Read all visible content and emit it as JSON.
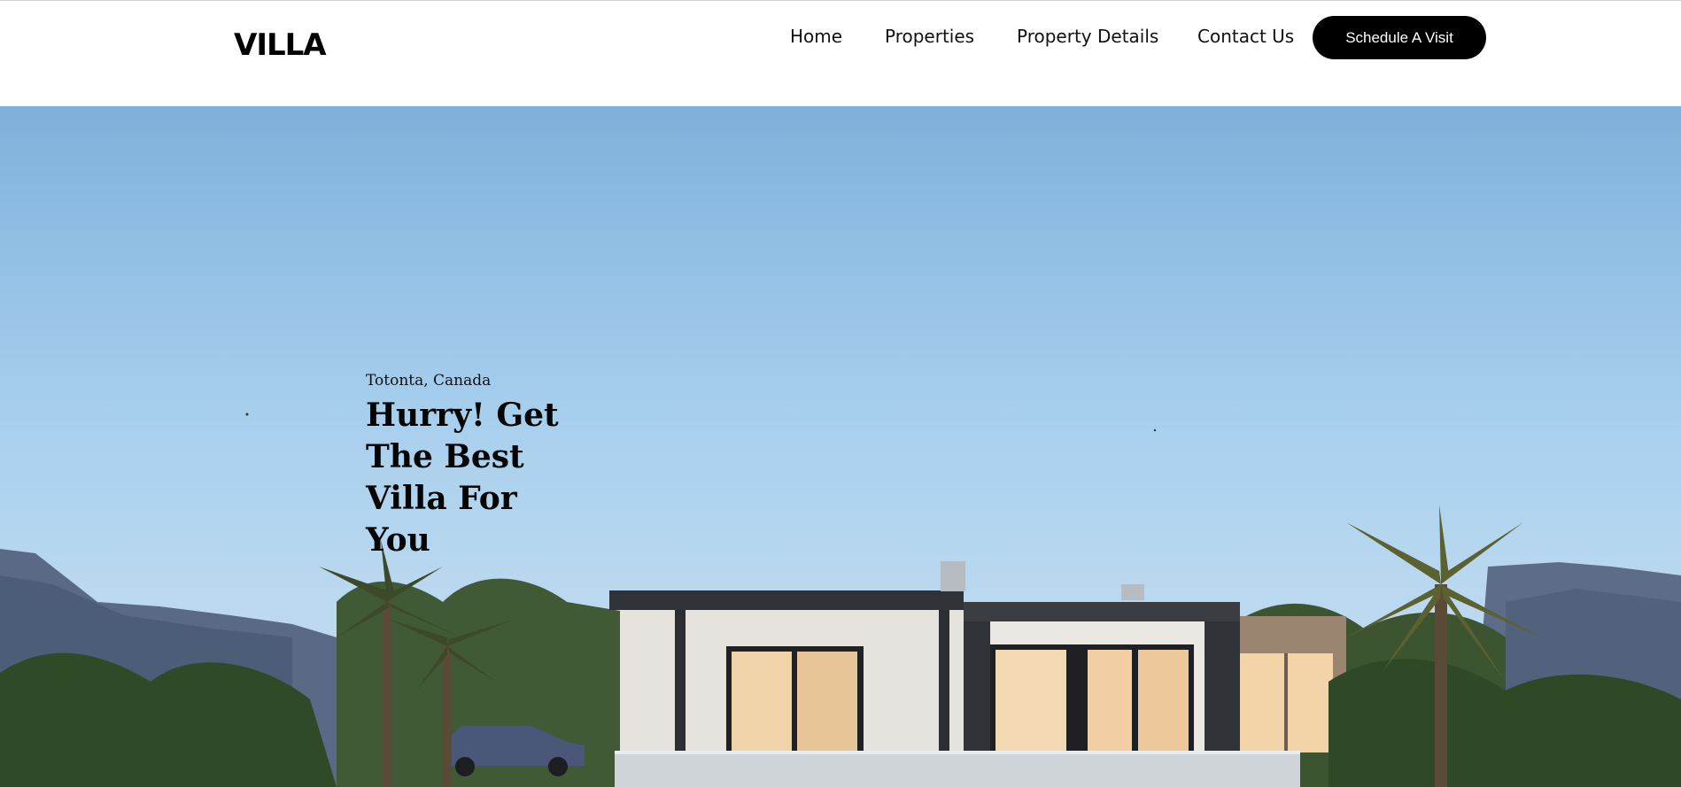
{
  "header": {
    "logo": "VILLA",
    "nav": {
      "home": "Home",
      "properties": "Properties",
      "property_details": "Property Details",
      "contact": "Contact Us"
    },
    "cta_label": "Schedule A Visit"
  },
  "hero": {
    "location": "Totonta, Canada",
    "headline": "Hurry! Get The Best Villa For You",
    "image": "modern-villa-with-palm-trees-photo"
  },
  "colors": {
    "cta_background": "#000000",
    "cta_text": "#ffffff",
    "sky_top": "#7fb0d9",
    "sky_bottom": "#c8dcee"
  }
}
